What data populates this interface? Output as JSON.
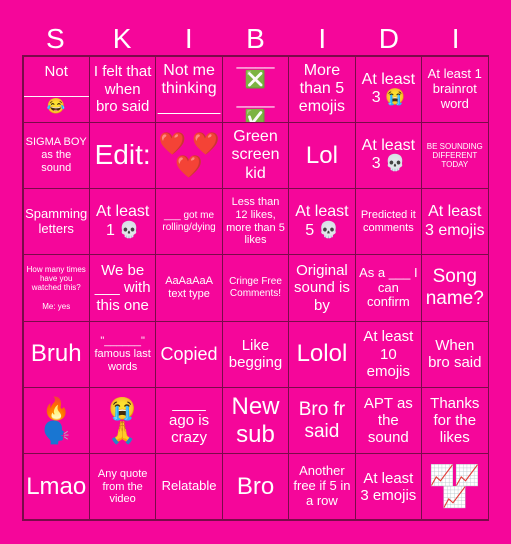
{
  "title_letters": [
    "S",
    "K",
    "I",
    "B",
    "I",
    "D",
    "I"
  ],
  "colors": {
    "background": "#f5069a",
    "grid_line": "#7a0a4a",
    "text": "#ffffff"
  },
  "cells": [
    [
      "Not\n________\n😂",
      "I felt that when bro said",
      "Not me thinking\n_______",
      "____ ❎\n____ ✅",
      "More than 5 emojis",
      "At least 3 😭",
      "At least 1 brainrot word"
    ],
    [
      "SIGMA BOY as the sound",
      "Edit:",
      "❤️ ❤️\n❤️",
      "Green screen kid",
      "Lol",
      "At least 3 💀",
      "BE SOUNDING DIFFERENT TODAY"
    ],
    [
      "Spamming letters",
      "At least 1 💀",
      "___ got me rolling/dying",
      "Less than 12 likes, more than 5 likes",
      "At least 5 💀",
      "Predicted it comments",
      "At least 3 emojis"
    ],
    [
      "How many times have you watched this?\n\nMe: yes",
      "We be ___ with this one",
      "AaAaAaA text type",
      "Cringe Free Comments!",
      "Original sound is by",
      "As a ___ I can confirm",
      "Song name?"
    ],
    [
      "Bruh",
      "\"______\" famous last words",
      "Copied",
      "Like begging",
      "Lolol",
      "At least 10 emojis",
      "When bro said"
    ],
    [
      "🔥\n🗣️",
      "😭\n🙏",
      "____\nago is crazy",
      "New sub",
      "Bro fr said",
      "APT as the sound",
      "Thanks for the likes"
    ],
    [
      "Lmao",
      "Any quote from the video",
      "Relatable",
      "Bro",
      "Another free if 5 in a row",
      "At least 3 emojis",
      "📈📈\n📈"
    ]
  ]
}
